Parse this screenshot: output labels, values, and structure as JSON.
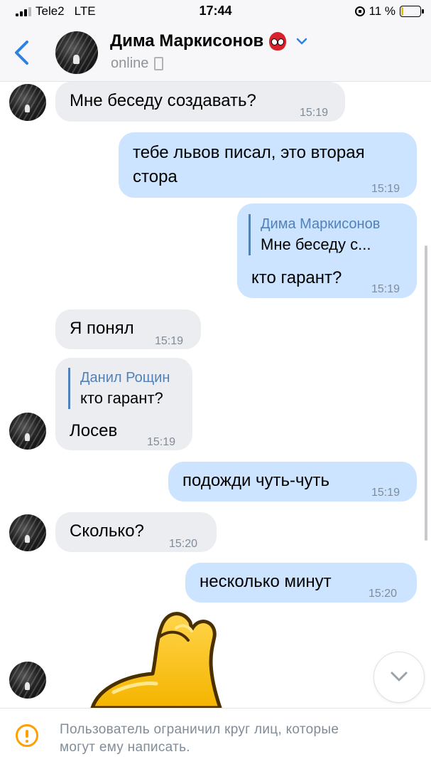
{
  "status_bar": {
    "carrier": "Tele2",
    "network": "LTE",
    "time": "17:44",
    "battery_text": "11 %",
    "battery_level": 0.11,
    "battery_color": "#e9c400"
  },
  "header": {
    "back_icon": "chevron-left-icon",
    "contact_name": "Дима Маркисонов",
    "status": "online",
    "accent_color": "#2d81e0"
  },
  "messages": [
    {
      "dir": "in",
      "text": "Мне беседу создавать?",
      "time": "15:19"
    },
    {
      "dir": "out",
      "text_lines": [
        "тебе львов писал, это вторая",
        "стора"
      ],
      "time": "15:19"
    },
    {
      "dir": "out",
      "reply_name": "Дима Маркисонов",
      "reply_text": "Мне беседу с...",
      "text": "кто гарант?",
      "time": "15:19"
    },
    {
      "dir": "in",
      "text": "Я понял",
      "time": "15:19"
    },
    {
      "dir": "in",
      "reply_name": "Данил Рощин",
      "reply_text": "кто гарант?",
      "text": "Лосев",
      "time": "15:19"
    },
    {
      "dir": "out",
      "text": "подожди чуть-чуть",
      "time": "15:19"
    },
    {
      "dir": "in",
      "text": "Сколько?",
      "time": "15:20"
    },
    {
      "dir": "out",
      "text": "несколько минут",
      "time": "15:20"
    }
  ],
  "footer": {
    "notice_lines": [
      "Пользователь ограничил круг лиц, которые",
      "могут ему написать."
    ],
    "icon": "warning-icon"
  },
  "colors": {
    "incoming_bubble": "#ebedf0",
    "outgoing_bubble": "#cce4ff",
    "reply_accent": "#5181b8",
    "warning": "#ffa000"
  }
}
